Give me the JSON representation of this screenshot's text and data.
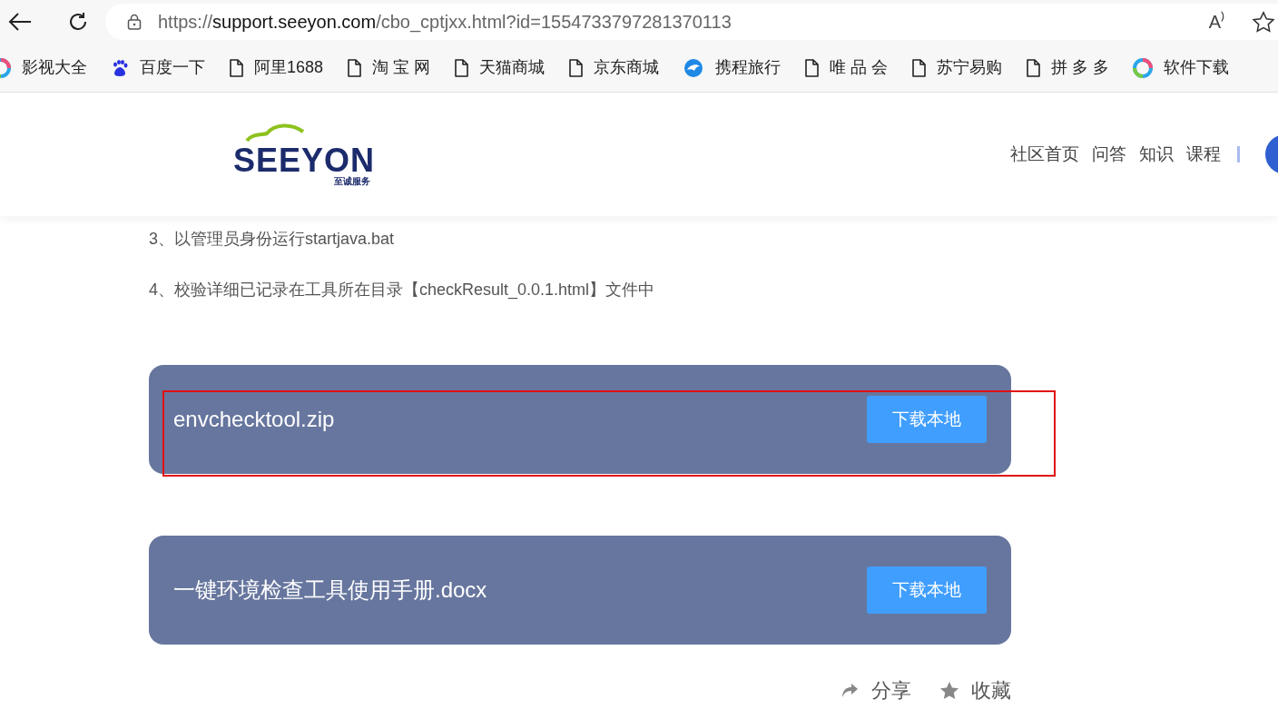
{
  "browser": {
    "url": {
      "scheme": "https://",
      "host": "support.seeyon.com",
      "path": "/cbo_cptjxx.html?id=1554733797281370113"
    },
    "read_aloud": "A⁾",
    "bookmarks": [
      {
        "label": "影视大全",
        "kind": "ring"
      },
      {
        "label": "百度一下",
        "kind": "paw"
      },
      {
        "label": "阿里1688",
        "kind": "page"
      },
      {
        "label": "淘 宝 网",
        "kind": "page"
      },
      {
        "label": "天猫商城",
        "kind": "page"
      },
      {
        "label": "京东商城",
        "kind": "page"
      },
      {
        "label": "携程旅行",
        "kind": "dolphin"
      },
      {
        "label": "唯 品 会",
        "kind": "page"
      },
      {
        "label": "苏宁易购",
        "kind": "page"
      },
      {
        "label": "拼 多 多",
        "kind": "page"
      },
      {
        "label": "软件下载",
        "kind": "ring"
      }
    ]
  },
  "header": {
    "logo": {
      "wordmark": "SEEYON",
      "tagline": "至诚服务"
    },
    "nav": [
      "社区首页",
      "问答",
      "知识",
      "课程"
    ]
  },
  "steps": [
    "3、以管理员身份运行startjava.bat",
    "4、校验详细已记录在工具所在目录【checkResult_0.0.1.html】文件中"
  ],
  "attachments": [
    {
      "name": "envchecktool.zip",
      "button": "下载本地",
      "highlighted": true
    },
    {
      "name": "一键环境检查工具使用手册.docx",
      "button": "下载本地",
      "highlighted": false
    }
  ],
  "actions": [
    {
      "label": "分享",
      "kind": "share"
    },
    {
      "label": "收藏",
      "kind": "star"
    }
  ]
}
